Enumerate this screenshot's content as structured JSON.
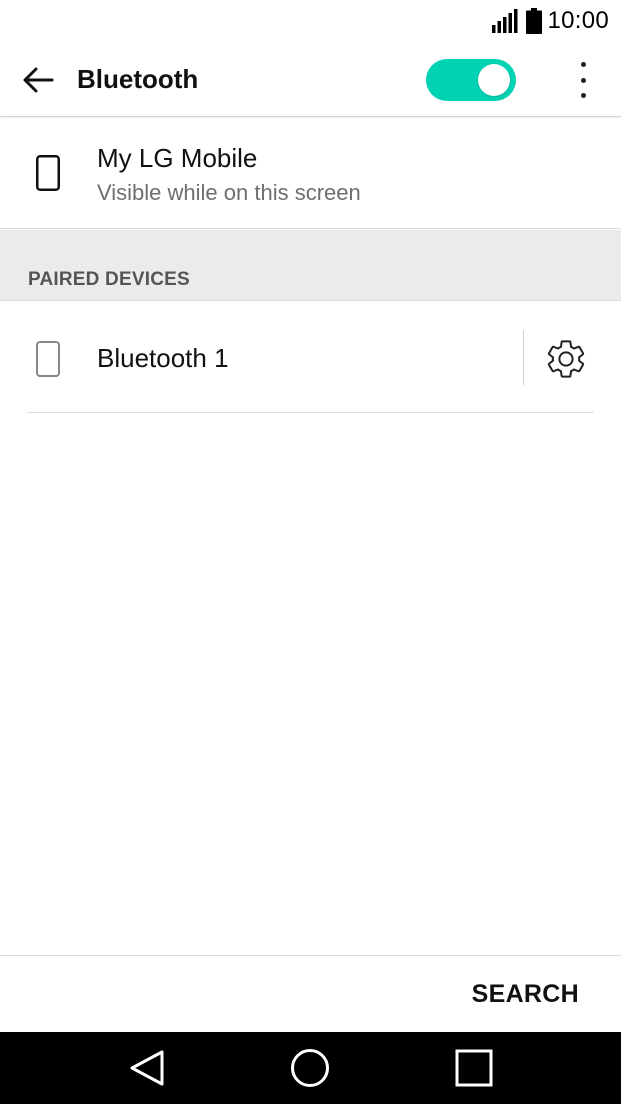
{
  "status_bar": {
    "time": "10:00",
    "icons": [
      "signal-icon",
      "battery-icon"
    ]
  },
  "app_bar": {
    "title": "Bluetooth",
    "toggle_state": "on",
    "accent_color": "#00d2b4",
    "icons": [
      "back-arrow-icon",
      "overflow-menu-icon"
    ]
  },
  "my_device": {
    "name": "My LG Mobile",
    "subtitle": "Visible while on this screen",
    "icon": "phone-icon"
  },
  "paired_section": {
    "header": "PAIRED DEVICES",
    "devices": [
      {
        "name": "Bluetooth 1",
        "icon": "phone-icon",
        "action_icon": "gear-icon"
      }
    ]
  },
  "bottom_bar": {
    "search_label": "SEARCH"
  },
  "nav_bar": {
    "icons": [
      "nav-back-icon",
      "nav-home-icon",
      "nav-recent-icon"
    ]
  }
}
